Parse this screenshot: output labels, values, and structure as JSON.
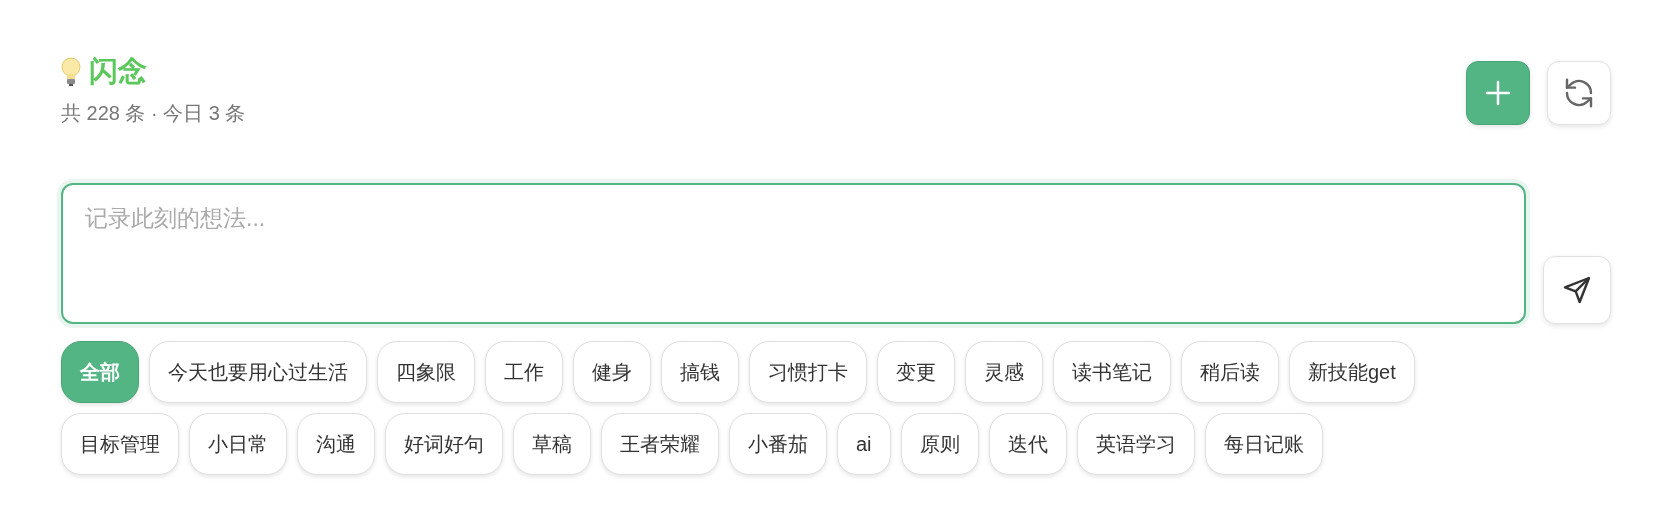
{
  "header": {
    "title": "闪念",
    "subtitle": "共 228 条 · 今日 3 条"
  },
  "composer": {
    "placeholder": "记录此刻的想法..."
  },
  "tags": [
    {
      "label": "全部",
      "selected": true
    },
    {
      "label": "今天也要用心过生活",
      "selected": false
    },
    {
      "label": "四象限",
      "selected": false
    },
    {
      "label": "工作",
      "selected": false
    },
    {
      "label": "健身",
      "selected": false
    },
    {
      "label": "搞钱",
      "selected": false
    },
    {
      "label": "习惯打卡",
      "selected": false
    },
    {
      "label": "变更",
      "selected": false
    },
    {
      "label": "灵感",
      "selected": false
    },
    {
      "label": "读书笔记",
      "selected": false
    },
    {
      "label": "稍后读",
      "selected": false
    },
    {
      "label": "新技能get",
      "selected": false
    },
    {
      "label": "目标管理",
      "selected": false
    },
    {
      "label": "小日常",
      "selected": false
    },
    {
      "label": "沟通",
      "selected": false
    },
    {
      "label": "好词好句",
      "selected": false
    },
    {
      "label": "草稿",
      "selected": false
    },
    {
      "label": "王者荣耀",
      "selected": false
    },
    {
      "label": "小番茄",
      "selected": false
    },
    {
      "label": "ai",
      "selected": false
    },
    {
      "label": "原则",
      "selected": false
    },
    {
      "label": "迭代",
      "selected": false
    },
    {
      "label": "英语学习",
      "selected": false
    },
    {
      "label": "每日记账",
      "selected": false
    }
  ]
}
